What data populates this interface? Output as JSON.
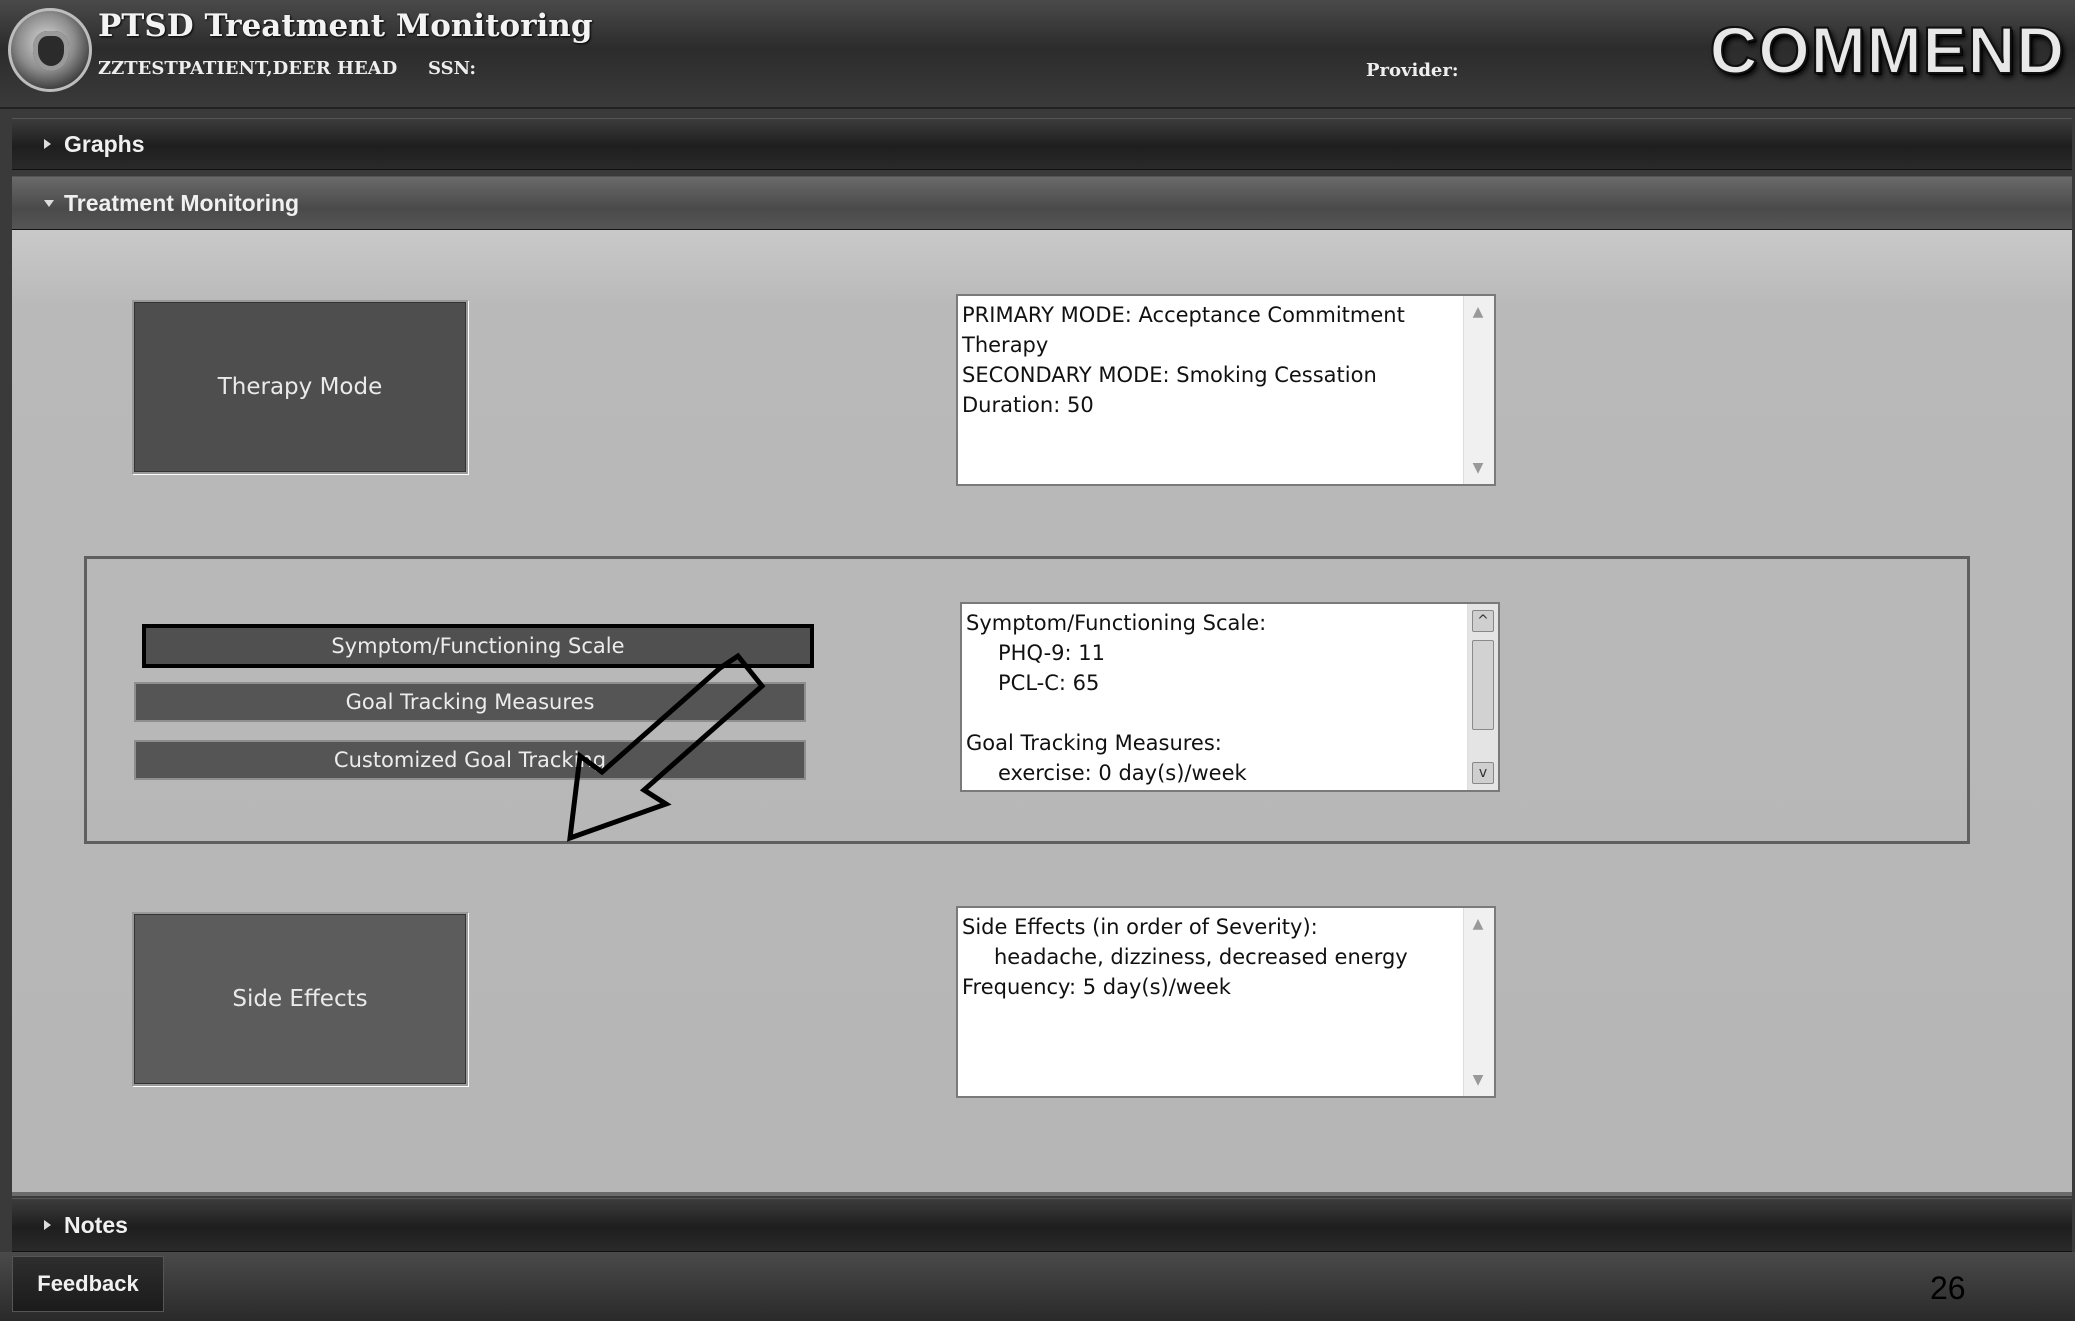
{
  "header": {
    "app_title": "PTSD Treatment Monitoring",
    "patient": "ZZTESTPATIENT,DEER HEAD",
    "ssn_label": "SSN:",
    "provider_label": "Provider:",
    "brand": "COMMEND"
  },
  "sections": {
    "graphs": "Graphs",
    "treatment_monitoring": "Treatment Monitoring",
    "notes": "Notes"
  },
  "treatment": {
    "therapy_mode_button": "Therapy Mode",
    "therapy_mode_text": [
      "PRIMARY MODE: Acceptance Commitment",
      "Therapy",
      "SECONDARY MODE: Smoking Cessation",
      "Duration: 50"
    ],
    "symptom_button": "Symptom/Functioning Scale",
    "goal_button": "Goal Tracking Measures",
    "custom_goal_button": "Customized Goal Tracking",
    "symptom_text": {
      "heading": "Symptom/Functioning Scale:",
      "phq9": "PHQ-9: 11",
      "pclc": "PCL-C: 65",
      "goal_heading": "Goal Tracking Measures:",
      "exercise": "exercise: 0 day(s)/week"
    },
    "side_effects_button": "Side Effects",
    "side_effects_text": {
      "heading": "Side Effects (in order of Severity):",
      "effects": "headache, dizziness, decreased energy",
      "frequency": "Frequency: 5 day(s)/week"
    }
  },
  "footer": {
    "feedback": "Feedback",
    "slide_number": "26"
  },
  "icons": {
    "collapsed": "triangle-right-icon",
    "expanded": "triangle-down-icon",
    "pointer": "outline-arrow-icon",
    "seal": "va-seal-icon"
  }
}
